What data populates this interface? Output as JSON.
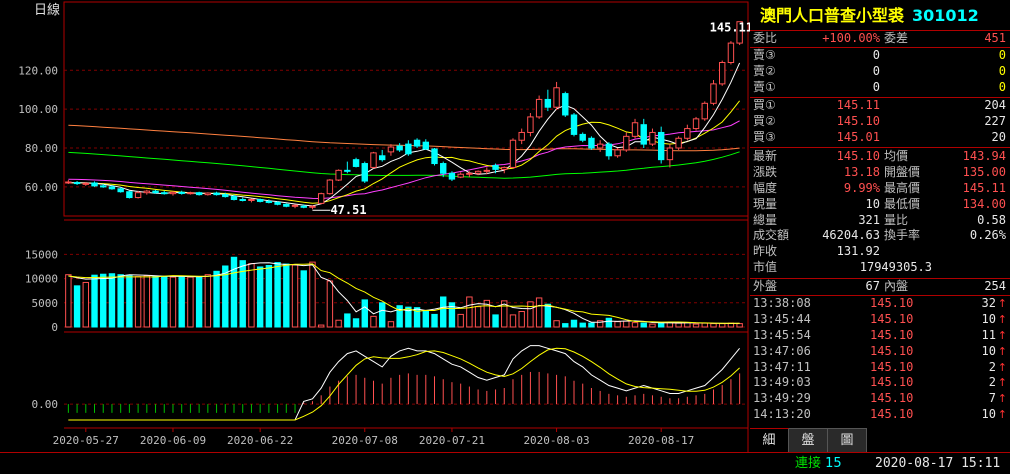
{
  "panel_label": "日線",
  "stock": {
    "name": "澳門人口普查小型裘",
    "code": "301012"
  },
  "colors": {
    "up": "#ff5050",
    "down": "#00ffff",
    "grid": "#800000",
    "ma5": "#ffffff",
    "ma10": "#ffff00",
    "ma20": "#ff40ff",
    "ma60": "#00ff00",
    "ma120": "#ff8040"
  },
  "chart_data": {
    "type": "candlestick",
    "price_ticks": [
      "120.00",
      "100.00",
      "80.00",
      "60.00"
    ],
    "price_ylim": [
      45,
      150
    ],
    "volume_ticks": [
      "15000",
      "10000",
      "5000",
      "0"
    ],
    "volume_ylim": [
      0,
      19000
    ],
    "indicator_ticks": [
      "0.00"
    ],
    "x_ticks": [
      "2020-05-27",
      "2020-06-09",
      "2020-06-22",
      "2020-07-08",
      "2020-07-21",
      "2020-08-03",
      "2020-08-17"
    ],
    "annotations": [
      {
        "text": "145.11",
        "kind": "high"
      },
      {
        "text": "47.51",
        "kind": "low"
      }
    ],
    "ohlc": [
      [
        62.5,
        63.5,
        61.5,
        62.5
      ],
      [
        62.2,
        63,
        61,
        62
      ],
      [
        61.5,
        62.5,
        60.5,
        61.8
      ],
      [
        62,
        62.8,
        60,
        60.5
      ],
      [
        60.5,
        61.5,
        59.5,
        60
      ],
      [
        60,
        60.8,
        58.5,
        59
      ],
      [
        59,
        59.8,
        57,
        57.5
      ],
      [
        57.5,
        58,
        54,
        54.5
      ],
      [
        54.5,
        58,
        54,
        57
      ],
      [
        57,
        58.5,
        56,
        57.8
      ],
      [
        57.8,
        58.5,
        56.5,
        57
      ],
      [
        57,
        58,
        56,
        56.5
      ],
      [
        56.5,
        57.8,
        55.5,
        57.2
      ],
      [
        57.2,
        58,
        56,
        56.6
      ],
      [
        56.6,
        57.5,
        56,
        57
      ],
      [
        57,
        57.5,
        55.5,
        56
      ],
      [
        56,
        57.2,
        55.5,
        56.8
      ],
      [
        56.8,
        57.5,
        55.5,
        56
      ],
      [
        56,
        57,
        54.5,
        55
      ],
      [
        55,
        56,
        53,
        53.5
      ],
      [
        53.5,
        54.5,
        52.5,
        53
      ],
      [
        53,
        54,
        52,
        53.5
      ],
      [
        53.5,
        54,
        52,
        52.5
      ],
      [
        52.5,
        53.5,
        51.5,
        52
      ],
      [
        52,
        52.5,
        50.5,
        51
      ],
      [
        51,
        51.5,
        49.5,
        50
      ],
      [
        50,
        51,
        49,
        50.5
      ],
      [
        50,
        51,
        49,
        49.5
      ],
      [
        49.5,
        50.5,
        48.5,
        50
      ],
      [
        51.5,
        57,
        51,
        56.5
      ],
      [
        56.5,
        64,
        56,
        63.5
      ],
      [
        63.5,
        69,
        63,
        68.5
      ],
      [
        68.5,
        73,
        67,
        68
      ],
      [
        74,
        75,
        70,
        70.5
      ],
      [
        72,
        73,
        62,
        63
      ],
      [
        70,
        78,
        69.5,
        77.5
      ],
      [
        76,
        79,
        73,
        74
      ],
      [
        78,
        82,
        76,
        80.5
      ],
      [
        81,
        82.5,
        78,
        79
      ],
      [
        82,
        84,
        76,
        77
      ],
      [
        84,
        85,
        80,
        81
      ],
      [
        83,
        84.5,
        79,
        79.5
      ],
      [
        79.5,
        80,
        71,
        72
      ],
      [
        72,
        73,
        65,
        67
      ],
      [
        67,
        68,
        63,
        64
      ],
      [
        65,
        67.5,
        64.5,
        66.5
      ],
      [
        66.5,
        68,
        65,
        67
      ],
      [
        67,
        68.5,
        66,
        68
      ],
      [
        68,
        70,
        66.5,
        68.5
      ],
      [
        71,
        72,
        67,
        69
      ],
      [
        69,
        70.5,
        67,
        70
      ],
      [
        70,
        85,
        69.5,
        84
      ],
      [
        84,
        90,
        82,
        88
      ],
      [
        88,
        98,
        86,
        96
      ],
      [
        96,
        107,
        95,
        105
      ],
      [
        105,
        110,
        99,
        101
      ],
      [
        101,
        114,
        99.5,
        111
      ],
      [
        108,
        109,
        96,
        97
      ],
      [
        97,
        98,
        86,
        87
      ],
      [
        87,
        88,
        83,
        84
      ],
      [
        85,
        86,
        79,
        80
      ],
      [
        80,
        84,
        78,
        82
      ],
      [
        82,
        83,
        74,
        76
      ],
      [
        76,
        80,
        75,
        79
      ],
      [
        79,
        88,
        78,
        86
      ],
      [
        86,
        95,
        85,
        93
      ],
      [
        92,
        95,
        80,
        82
      ],
      [
        82,
        90,
        81,
        88
      ],
      [
        88,
        91,
        72,
        74
      ],
      [
        74,
        82,
        70,
        80
      ],
      [
        80,
        86,
        79,
        85
      ],
      [
        85,
        92,
        84,
        90
      ],
      [
        90,
        96,
        89,
        95
      ],
      [
        95,
        104,
        94,
        103
      ],
      [
        103,
        115,
        102,
        113
      ],
      [
        113,
        125,
        112,
        124
      ],
      [
        124,
        135,
        123,
        134
      ],
      [
        134,
        145.11,
        133,
        145
      ]
    ],
    "volume": [
      10800,
      8500,
      9200,
      10700,
      10900,
      11000,
      10800,
      10600,
      10400,
      10600,
      10500,
      10400,
      10300,
      10500,
      10300,
      10400,
      10800,
      11500,
      12600,
      14400,
      13700,
      13100,
      12400,
      12700,
      13300,
      13000,
      12800,
      11600,
      13400,
      400,
      9500,
      1400,
      2700,
      1700,
      5600,
      2200,
      5000,
      1100,
      4400,
      4100,
      4000,
      3400,
      2600,
      6200,
      5000,
      2600,
      6200,
      4200,
      5500,
      2500,
      5400,
      2500,
      3200,
      5200,
      6000,
      4700,
      1300,
      700,
      1400,
      800,
      800,
      1300,
      1800,
      1100,
      1200,
      900,
      800,
      600,
      900,
      1000,
      800,
      900,
      600,
      800,
      700,
      700,
      800,
      700
    ],
    "indicator": [
      -0.3,
      -0.3,
      -0.3,
      -0.3,
      -0.3,
      -0.3,
      -0.3,
      -0.3,
      -0.3,
      -0.3,
      -0.3,
      -0.3,
      -0.3,
      -0.3,
      -0.3,
      -0.3,
      -0.3,
      -0.3,
      -0.3,
      -0.3,
      -0.3,
      -0.3,
      -0.3,
      -0.3,
      -0.3,
      -0.3,
      -0.3,
      0.05,
      0.1,
      0.3,
      0.6,
      0.8,
      0.95,
      1.0,
      0.9,
      0.8,
      0.7,
      0.9,
      1.0,
      1.05,
      1.0,
      1.0,
      0.95,
      0.85,
      0.75,
      0.7,
      0.6,
      0.5,
      0.45,
      0.5,
      0.55,
      0.85,
      1.0,
      1.1,
      1.1,
      1.05,
      1.0,
      0.95,
      0.8,
      0.7,
      0.55,
      0.45,
      0.35,
      0.3,
      0.25,
      0.3,
      0.35,
      0.3,
      0.25,
      0.2,
      0.2,
      0.25,
      0.3,
      0.35,
      0.5,
      0.65,
      0.85,
      1.05
    ]
  },
  "quote": {
    "ratio_label": "委比",
    "ratio": "+100.00%",
    "diff_label": "委差",
    "diff": "451",
    "asks": [
      {
        "label": "賣③",
        "price": "0",
        "vol": "0"
      },
      {
        "label": "賣②",
        "price": "0",
        "vol": "0"
      },
      {
        "label": "賣①",
        "price": "0",
        "vol": "0"
      }
    ],
    "bids": [
      {
        "label": "買①",
        "price": "145.11",
        "vol": "204"
      },
      {
        "label": "買②",
        "price": "145.10",
        "vol": "227"
      },
      {
        "label": "買③",
        "price": "145.01",
        "vol": "20"
      }
    ],
    "stats": [
      {
        "l1": "最新",
        "v1": "145.10",
        "c1": "red",
        "l2": "均價",
        "v2": "143.94",
        "c2": "red"
      },
      {
        "l1": "漲跌",
        "v1": "13.18",
        "c1": "red",
        "l2": "開盤價",
        "v2": "135.00",
        "c2": "red"
      },
      {
        "l1": "幅度",
        "v1": "9.99%",
        "c1": "red",
        "l2": "最高價",
        "v2": "145.11",
        "c2": "red"
      },
      {
        "l1": "現量",
        "v1": "10",
        "c1": "wht",
        "l2": "最低價",
        "v2": "134.00",
        "c2": "red"
      },
      {
        "l1": "總量",
        "v1": "321",
        "c1": "wht",
        "l2": "量比",
        "v2": "0.58",
        "c2": "wht"
      },
      {
        "l1": "成交額",
        "v1": "46204.63",
        "c1": "wht",
        "l2": "換手率",
        "v2": "0.26%",
        "c2": "wht"
      }
    ],
    "prev_label": "昨收",
    "prev": "131.92",
    "mcap_label": "市值",
    "mcap": "17949305.3",
    "outer_label": "外盤",
    "outer": "67",
    "inner_label": "內盤",
    "inner": "254"
  },
  "ticks": [
    {
      "time": "13:38:08",
      "price": "145.10",
      "qty": "32"
    },
    {
      "time": "13:45:44",
      "price": "145.10",
      "qty": "10"
    },
    {
      "time": "13:45:54",
      "price": "145.10",
      "qty": "11"
    },
    {
      "time": "13:47:06",
      "price": "145.10",
      "qty": "10"
    },
    {
      "time": "13:47:11",
      "price": "145.10",
      "qty": "2"
    },
    {
      "time": "13:49:03",
      "price": "145.10",
      "qty": "2"
    },
    {
      "time": "13:49:29",
      "price": "145.10",
      "qty": "7"
    },
    {
      "time": "14:13:20",
      "price": "145.10",
      "qty": "10"
    }
  ],
  "tick_arrow": "↑",
  "tabs": [
    "細",
    "盤",
    "圖"
  ],
  "status": {
    "conn_label": "連接",
    "conn_count": "15",
    "datetime": "2020-08-17 15:11"
  }
}
